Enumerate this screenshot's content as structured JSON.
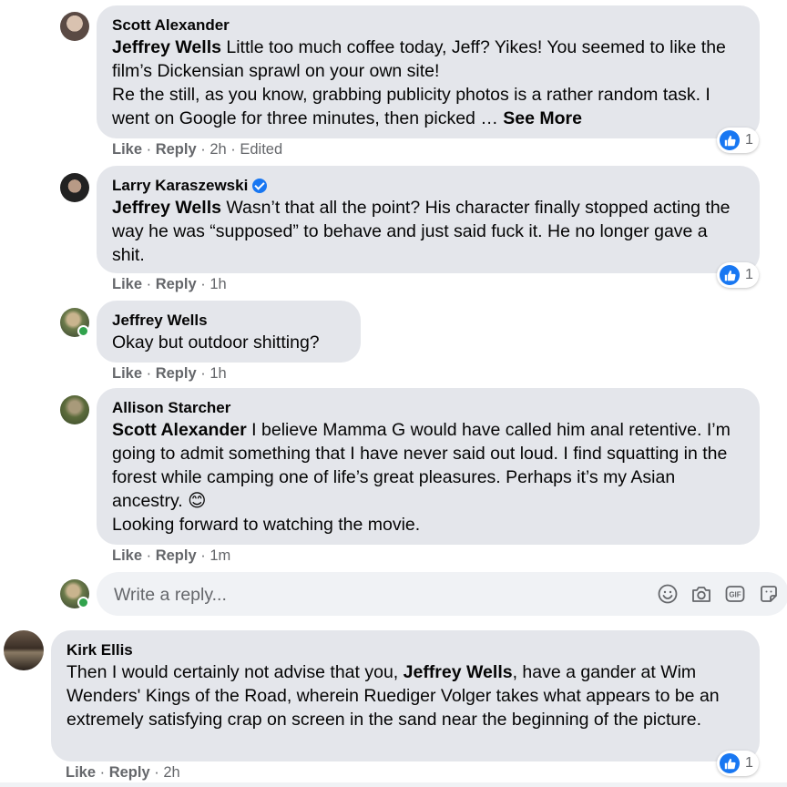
{
  "comments": [
    {
      "author": "Scott Alexander",
      "tag": "Jeffrey Wells",
      "text": " Little too much coffee today, Jeff? Yikes! You seemed to like the film’s Dickensian sprawl on your own site!\nRe the still, as you know, grabbing publicity photos is a rather random task. I went on Google for three minutes, then picked … ",
      "see_more": "See More",
      "like": "Like",
      "reply": "Reply",
      "time": "2h",
      "edited": "Edited",
      "reactions": "1"
    },
    {
      "author": "Larry Karaszewski",
      "tag": "Jeffrey Wells",
      "text": " Wasn’t that all the point? His character finally stopped acting the way he was “supposed” to behave and just said fuck it. He no longer gave a shit.",
      "like": "Like",
      "reply": "Reply",
      "time": "1h",
      "reactions": "1"
    },
    {
      "author": "Jeffrey Wells",
      "text": "Okay but outdoor shitting?",
      "like": "Like",
      "reply": "Reply",
      "time": "1h"
    },
    {
      "author": "Allison Starcher",
      "tag": "Scott Alexander",
      "text": " I believe Mamma G would have called him anal retentive. I’m going to admit something that I have never said out loud. I find squatting in the forest while camping one of life’s great pleasures. Perhaps it’s my Asian ancestry. 😊\nLooking forward to watching the movie.",
      "like": "Like",
      "reply": "Reply",
      "time": "1m"
    },
    {
      "author": "Kirk Ellis",
      "text_before": "Then I would certainly not advise that you, ",
      "tag": "Jeffrey Wells",
      "text_after": ", have a gander at Wim Wenders' Kings of the Road, wherein Ruediger Volger takes what appears to be an extremely satisfying crap on screen in the sand near the beginning of the picture.",
      "like": "Like",
      "reply": "Reply",
      "time": "2h",
      "reactions": "1"
    }
  ],
  "reply_box": {
    "placeholder": "Write a reply...",
    "icons": [
      "emoji-icon",
      "camera-icon",
      "gif-icon",
      "sticker-icon"
    ]
  },
  "colors": {
    "bubble": "#e4e6eb",
    "meta": "#65676b",
    "like_blue": "#1877f2",
    "online": "#31a24c"
  }
}
